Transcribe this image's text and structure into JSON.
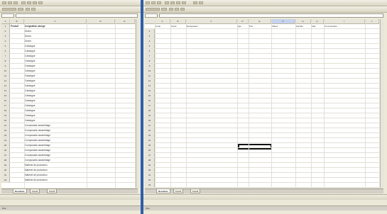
{
  "left": {
    "tabs": [
      "Resultats",
      "Feuil2",
      "Feuil3"
    ],
    "col_headers": [
      "A",
      "B",
      "C",
      "D",
      "E"
    ],
    "header_cells": [
      "Produit",
      "Designation abrege",
      ""
    ],
    "rows": [
      [
        "",
        "Divers"
      ],
      [
        "",
        "Divers"
      ],
      [
        "",
        "Divers"
      ],
      [
        "",
        "Catalogue"
      ],
      [
        "",
        "Catalogue"
      ],
      [
        "",
        "Catalogue"
      ],
      [
        "",
        "Catalogue"
      ],
      [
        "",
        "Catalogue"
      ],
      [
        "",
        "Catalogue"
      ],
      [
        "",
        "Catalogue"
      ],
      [
        "",
        "Catalogue"
      ],
      [
        "",
        "Catalogue"
      ],
      [
        "",
        "Catalogue"
      ],
      [
        "",
        "Catalogue"
      ],
      [
        "",
        "Catalogue"
      ],
      [
        "",
        "Catalogue"
      ],
      [
        "",
        "Catalogue"
      ],
      [
        "",
        "Catalogue"
      ],
      [
        "",
        "Catalogue"
      ],
      [
        "",
        "Composants assemblage"
      ],
      [
        "",
        "Composants assemblage"
      ],
      [
        "",
        "Composants assemblage"
      ],
      [
        "",
        "Composants assemblage"
      ],
      [
        "",
        "Composants assemblage"
      ],
      [
        "",
        "Composants assemblage"
      ],
      [
        "",
        "Composants assemblage"
      ],
      [
        "",
        "Composants assemblage"
      ],
      [
        "",
        "Materiel de production"
      ],
      [
        "",
        "Materiel de production"
      ],
      [
        "",
        "Materiel de production"
      ],
      [
        "",
        "Materiel de production"
      ],
      [
        "",
        "Materiel de production"
      ]
    ]
  },
  "right": {
    "tabs": [
      "Resultats",
      "Feuil2",
      "Feuil3"
    ],
    "col_headers": [
      "A",
      "B",
      "C",
      "D",
      "E",
      "F",
      "G",
      "H",
      "I",
      "J"
    ],
    "header_cells": [
      "",
      "Code",
      "Stock",
      "Designation",
      "Qte",
      "Prix",
      "Valeur",
      "Famille",
      "Stat",
      "Commentaire"
    ]
  },
  "status": {
    "left": "Pret",
    "right": "Pret"
  }
}
